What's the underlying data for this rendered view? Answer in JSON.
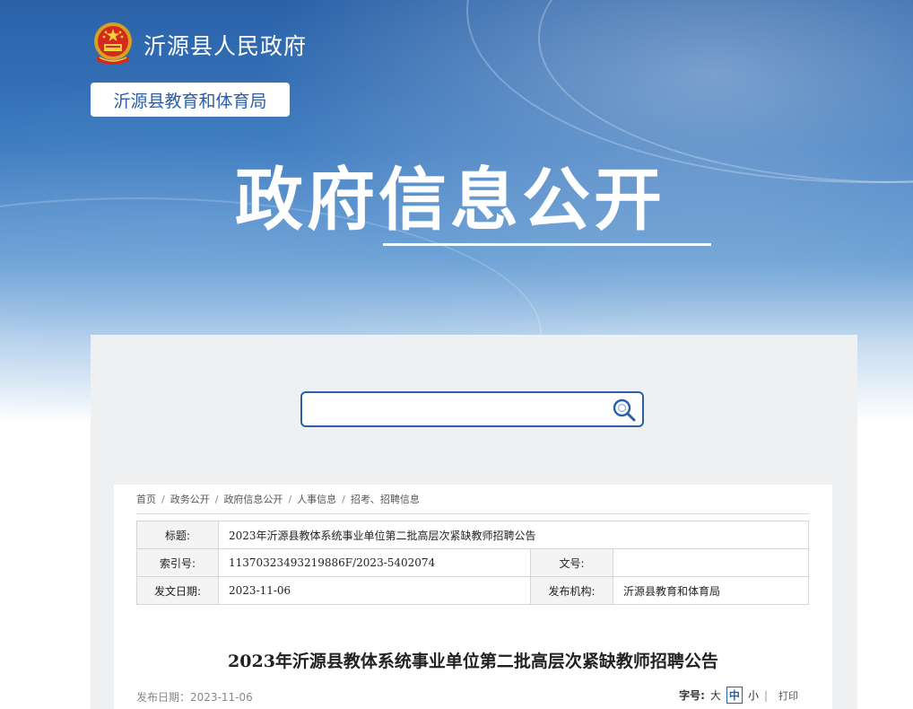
{
  "header": {
    "site_name": "沂源县人民政府",
    "department": "沂源县教育和体育局",
    "section_title": "政府信息公开"
  },
  "search": {
    "placeholder": "",
    "icon": "search-icon"
  },
  "breadcrumb": [
    "首页",
    "政务公开",
    "政府信息公开",
    "人事信息",
    "招考、招聘信息"
  ],
  "info_table": {
    "title_label": "标题:",
    "title_value": "2023年沂源县教体系统事业单位第二批高层次紧缺教师招聘公告",
    "index_label": "索引号:",
    "index_value": "11370323493219886F/2023-5402074",
    "docno_label": "文号:",
    "docno_value": "",
    "date_label": "发文日期:",
    "date_value": "2023-11-06",
    "org_label": "发布机构:",
    "org_value": "沂源县教育和体育局"
  },
  "article": {
    "title": "2023年沂源县教体系统事业单位第二批高层次紧缺教师招聘公告",
    "pub_date": "发布日期：2023-11-06"
  },
  "tools": {
    "font_size_label": "字号:",
    "size_large": "大",
    "size_medium": "中",
    "size_small": "小",
    "divider": "|",
    "print": "打印"
  },
  "colors": {
    "primary": "#2a5fa6",
    "panel_bg": "#eff0f2"
  }
}
